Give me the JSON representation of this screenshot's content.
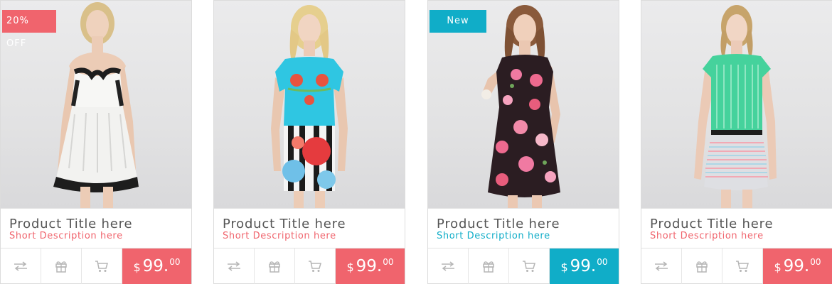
{
  "colors": {
    "accent_red": "#f0646d",
    "accent_blue": "#10adc8",
    "icon_gray": "#b5b5b5"
  },
  "products": [
    {
      "badge": "20% OFF",
      "title": "Product Title here",
      "description": "Short Description here",
      "price": {
        "currency": "$",
        "whole": "99.",
        "cents": "00"
      },
      "price_color": "#f0646d",
      "desc_color": "#f0646d",
      "image": "woman in white strapless dress with black lace trim",
      "actions": [
        "compare-icon",
        "gift-icon",
        "cart-icon"
      ]
    },
    {
      "badge": "",
      "title": "Product Title here",
      "description": "Short Description here",
      "price": {
        "currency": "$",
        "whole": "99.",
        "cents": "00"
      },
      "price_color": "#f0646d",
      "desc_color": "#f0646d",
      "image": "woman in turquoise embroidered top and floral striped skirt",
      "actions": [
        "compare-icon",
        "gift-icon",
        "cart-icon"
      ]
    },
    {
      "badge": "New",
      "title": "Product Title here",
      "description": "Short Description here",
      "price": {
        "currency": "$",
        "whole": "99.",
        "cents": "00"
      },
      "price_color": "#10adc8",
      "desc_color": "#10adc8",
      "image": "woman in dark floral print dress",
      "actions": [
        "compare-icon",
        "gift-icon",
        "cart-icon"
      ]
    },
    {
      "badge": "",
      "title": "Product Title here",
      "description": "Short Description here",
      "price": {
        "currency": "$",
        "whole": "99.",
        "cents": "00"
      },
      "price_color": "#f0646d",
      "desc_color": "#f0646d",
      "image": "woman in mint striped top and pastel knit skirt",
      "actions": [
        "compare-icon",
        "gift-icon",
        "cart-icon"
      ]
    }
  ]
}
